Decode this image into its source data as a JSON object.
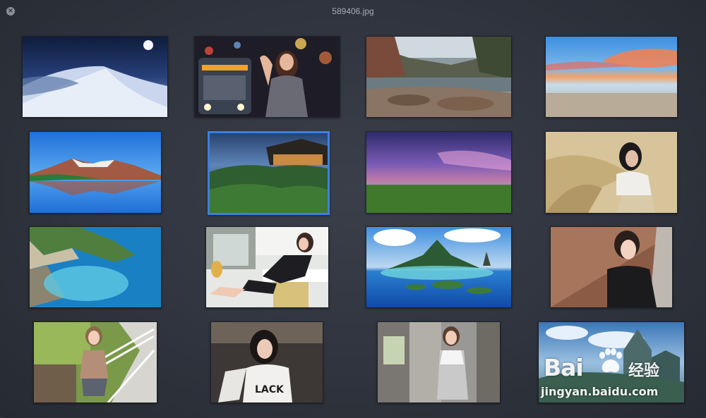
{
  "window": {
    "title": "589406.jpg"
  },
  "icons": {
    "close": "close-icon",
    "paw": "baidu-paw-icon"
  },
  "colors": {
    "selection": "#3d7fe0",
    "background": "#30343e",
    "title_text": "#a9acb2"
  },
  "thumbnails": [
    {
      "name": "snowy-dunes-night"
    },
    {
      "name": "woman-city-lights"
    },
    {
      "name": "lake-rocks-autumn"
    },
    {
      "name": "sunset-beach"
    },
    {
      "name": "mountain-lake-reflection"
    },
    {
      "name": "temple-forest-dusk",
      "selected": true
    },
    {
      "name": "purple-sky-field"
    },
    {
      "name": "woman-wheat-field"
    },
    {
      "name": "turquoise-cove-cliffs"
    },
    {
      "name": "woman-cafe-table"
    },
    {
      "name": "tropical-island-lagoon"
    },
    {
      "name": "woman-brick-wall"
    },
    {
      "name": "woman-stair-railing"
    },
    {
      "name": "woman-black-shirt"
    },
    {
      "name": "woman-corridor-pillar"
    },
    {
      "name": "fantasy-castle-sky"
    }
  ],
  "watermark": {
    "logo": "Bai",
    "logo_suffix": "经验",
    "url": "jingyan.baidu.com"
  }
}
